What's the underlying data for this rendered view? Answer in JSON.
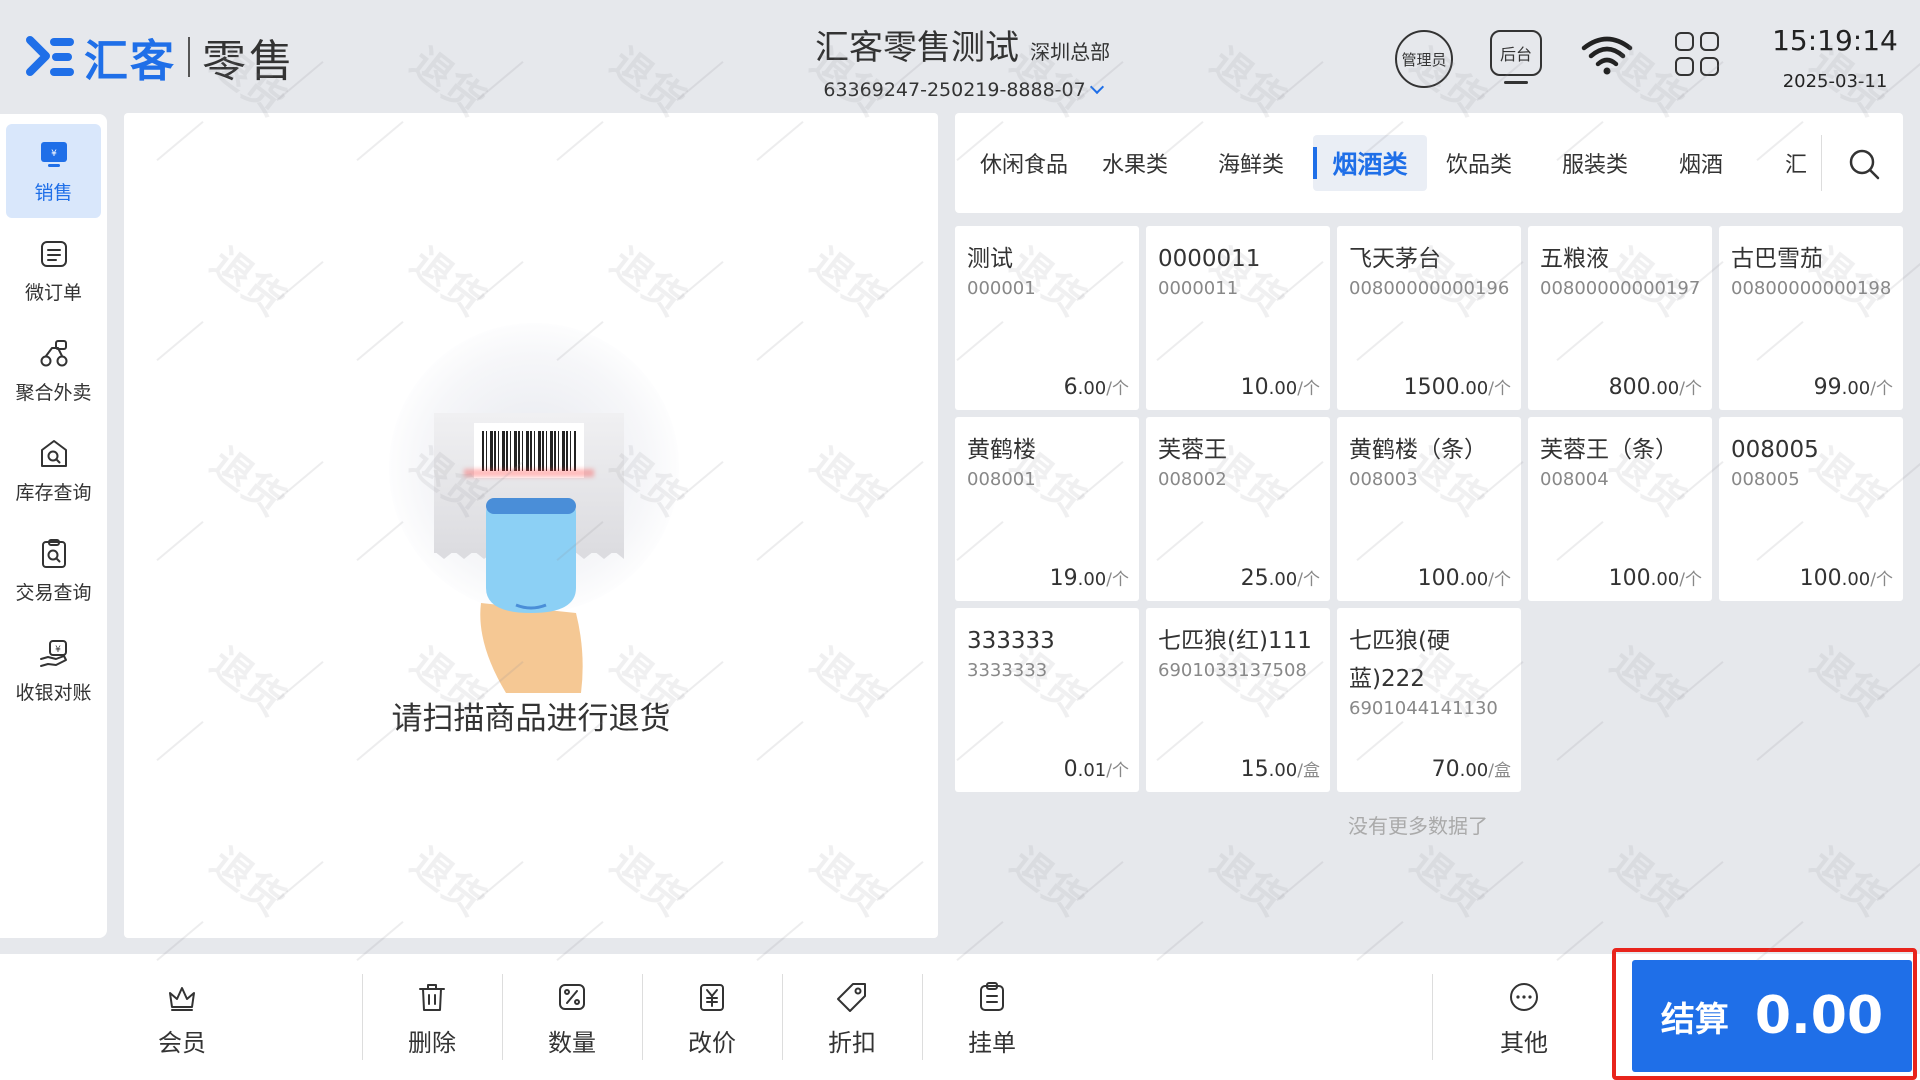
{
  "header": {
    "logo_brand": "汇客",
    "logo_product": "零售",
    "store_name": "汇客零售测试",
    "store_branch": "深圳总部",
    "store_id": "63369247-250219-8888-07",
    "admin_label": "管理员",
    "backstage_label": "后台",
    "time": "15:19:14",
    "date": "2025-03-11"
  },
  "watermark_text": "退货",
  "sidebar": {
    "items": [
      {
        "label": "销售",
        "icon": "sales-icon",
        "active": true
      },
      {
        "label": "微订单",
        "icon": "micro-order-icon",
        "active": false
      },
      {
        "label": "聚合外卖",
        "icon": "delivery-icon",
        "active": false
      },
      {
        "label": "库存查询",
        "icon": "inventory-search-icon",
        "active": false
      },
      {
        "label": "交易查询",
        "icon": "transaction-search-icon",
        "active": false
      },
      {
        "label": "收银对账",
        "icon": "reconciliation-icon",
        "active": false
      }
    ]
  },
  "scan": {
    "prompt": "请扫描商品进行退货"
  },
  "categories": {
    "items": [
      "休闲食品",
      "水果类",
      "海鲜类",
      "烟酒类",
      "饮品类",
      "服装类",
      "烟酒",
      "汇"
    ],
    "active_index": 3
  },
  "products": [
    {
      "name": "测试",
      "code": "000001",
      "price_int": "6",
      "price_dec": ".00",
      "unit": "/个"
    },
    {
      "name": "0000011",
      "code": "0000011",
      "price_int": "10",
      "price_dec": ".00",
      "unit": "/个"
    },
    {
      "name": "飞天茅台",
      "code": "00800000000196",
      "price_int": "1500",
      "price_dec": ".00",
      "unit": "/个"
    },
    {
      "name": "五粮液",
      "code": "00800000000197",
      "price_int": "800",
      "price_dec": ".00",
      "unit": "/个"
    },
    {
      "name": "古巴雪茄",
      "code": "00800000000198",
      "price_int": "99",
      "price_dec": ".00",
      "unit": "/个"
    },
    {
      "name": "黄鹤楼",
      "code": "008001",
      "price_int": "19",
      "price_dec": ".00",
      "unit": "/个"
    },
    {
      "name": "芙蓉王",
      "code": "008002",
      "price_int": "25",
      "price_dec": ".00",
      "unit": "/个"
    },
    {
      "name": "黄鹤楼（条）",
      "code": "008003",
      "price_int": "100",
      "price_dec": ".00",
      "unit": "/个"
    },
    {
      "name": "芙蓉王（条）",
      "code": "008004",
      "price_int": "100",
      "price_dec": ".00",
      "unit": "/个"
    },
    {
      "name": "008005",
      "code": "008005",
      "price_int": "100",
      "price_dec": ".00",
      "unit": "/个"
    },
    {
      "name": "333333",
      "code": "3333333",
      "price_int": "0",
      "price_dec": ".01",
      "unit": "/个"
    },
    {
      "name": "七匹狼(红)111",
      "code": "6901033137508",
      "price_int": "15",
      "price_dec": ".00",
      "unit": "/盒"
    },
    {
      "name": "七匹狼(硬蓝)222",
      "code": "6901044141130",
      "price_int": "70",
      "price_dec": ".00",
      "unit": "/盒"
    }
  ],
  "no_more_text": "没有更多数据了",
  "bottom": {
    "member": "会员",
    "delete": "删除",
    "quantity": "数量",
    "change_price": "改价",
    "discount": "折扣",
    "hold_order": "挂单",
    "other": "其他",
    "checkout_label": "结算",
    "checkout_amount": "0.00"
  },
  "colors": {
    "accent": "#1f6fe8",
    "highlight_border": "#e8241c",
    "active_bg": "#d9e7fb"
  }
}
